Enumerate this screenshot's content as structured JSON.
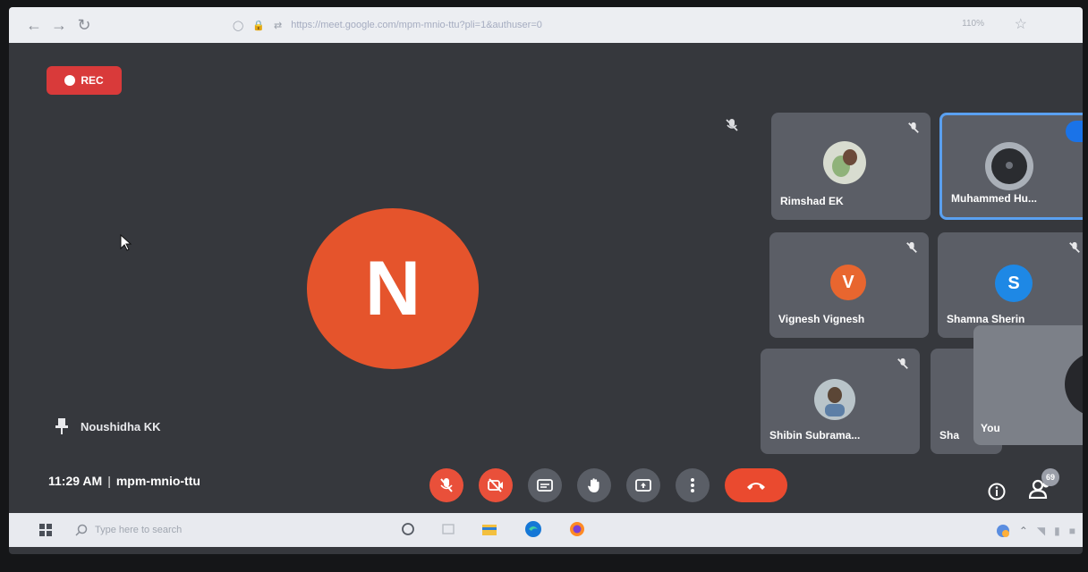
{
  "browser": {
    "url": "https://meet.google.com/mpm-mnio-ttu?pli=1&authuser=0",
    "zoom": "110%"
  },
  "recording": {
    "label": "REC"
  },
  "main_participant": {
    "initial": "N",
    "name": "Noushidha KK",
    "color": "#e5542c"
  },
  "participants": [
    {
      "name": "Rimshad EK",
      "avatar": "photo"
    },
    {
      "name": "Muhammed Hu...",
      "avatar": "photo"
    },
    {
      "name": "Vignesh Vignesh",
      "initial": "V",
      "color": "#e8662f"
    },
    {
      "name": "Shamna Sherin",
      "initial": "S",
      "color": "#1e88e5"
    },
    {
      "name": "Shibin Subrama...",
      "avatar": "photo"
    },
    {
      "name": "Sha"
    }
  ],
  "self_tile": {
    "label": "You"
  },
  "meeting": {
    "time": "11:29 AM",
    "separator": "|",
    "code": "mpm-mnio-ttu"
  },
  "people_count": "69",
  "taskbar": {
    "search_placeholder": "Type here to search"
  },
  "icons": {
    "controls": [
      "mic-off-icon",
      "camera-off-icon",
      "captions-icon",
      "raise-hand-icon",
      "present-icon",
      "more-icon",
      "hangup-icon"
    ],
    "right": [
      "info-icon",
      "people-icon"
    ]
  }
}
